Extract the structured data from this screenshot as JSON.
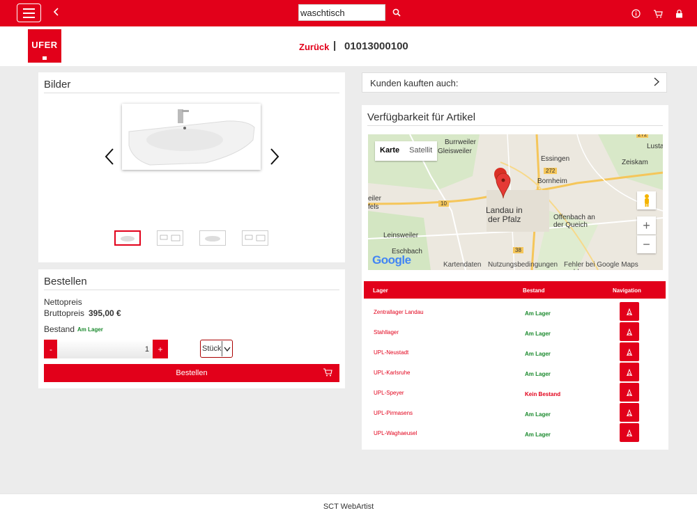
{
  "search": {
    "value": "waschtisch",
    "placeholder": ""
  },
  "header": {
    "logo": "UFER",
    "back_label": "Zurück",
    "separator": "|",
    "article_number": "01013000100"
  },
  "images": {
    "title": "Bilder"
  },
  "order": {
    "title": "Bestellen",
    "net_label": "Nettopreis",
    "gross_label": "Bruttopreis",
    "gross_value": "395,00 €",
    "stock_label": "Bestand",
    "stock_value": "Am Lager",
    "minus": "-",
    "plus": "+",
    "quantity": "1",
    "unit": "Stück",
    "button_label": "Bestellen"
  },
  "also_bought": {
    "label": "Kunden kauften auch:"
  },
  "availability": {
    "title": "Verfügbarkeit für Artikel",
    "map": {
      "tab_map": "Karte",
      "tab_satellite": "Satellit",
      "zoom_in": "+",
      "zoom_out": "−",
      "google": "Google",
      "footer": [
        "Kartendaten",
        "Nutzungsbedingungen",
        "Fehler bei Google Maps melden"
      ],
      "places": [
        "Burrweiler",
        "Gleisweiler",
        "Essingen",
        "Lusta",
        "Zeiskam",
        "Bornheim",
        "eiler",
        "fels",
        "Landau in",
        "der Pfalz",
        "Offenbach an",
        "der Queich",
        "Leinsweiler",
        "Eschbach"
      ],
      "roads": [
        "272",
        "272",
        "10",
        "38"
      ]
    },
    "columns": [
      "Lager",
      "Bestand",
      "Navigation"
    ],
    "rows": [
      {
        "name": "Zentrallager Landau",
        "stock": "Am Lager",
        "status": "in"
      },
      {
        "name": "Stahllager",
        "stock": "Am Lager",
        "status": "in"
      },
      {
        "name": "UPL-Neustadt",
        "stock": "Am Lager",
        "status": "in"
      },
      {
        "name": "UPL-Karlsruhe",
        "stock": "Am Lager",
        "status": "in"
      },
      {
        "name": "UPL-Speyer",
        "stock": "Kein Bestand",
        "status": "out"
      },
      {
        "name": "UPL-Pirmasens",
        "stock": "Am Lager",
        "status": "in"
      },
      {
        "name": "UPL-Waghaeusel",
        "stock": "Am Lager",
        "status": "in"
      }
    ]
  },
  "footer": {
    "text": "SCT WebArtist"
  },
  "colors": {
    "brand": "#e2001a",
    "in_stock": "#1b8a2e",
    "background": "#ececec"
  },
  "icons": [
    "menu-icon",
    "back-arrow-icon",
    "search-icon",
    "info-icon",
    "cart-icon",
    "lock-icon",
    "chevron-left-icon",
    "chevron-right-icon",
    "cart-icon",
    "map-pin-icon",
    "pegman-icon",
    "navigation-icon"
  ]
}
